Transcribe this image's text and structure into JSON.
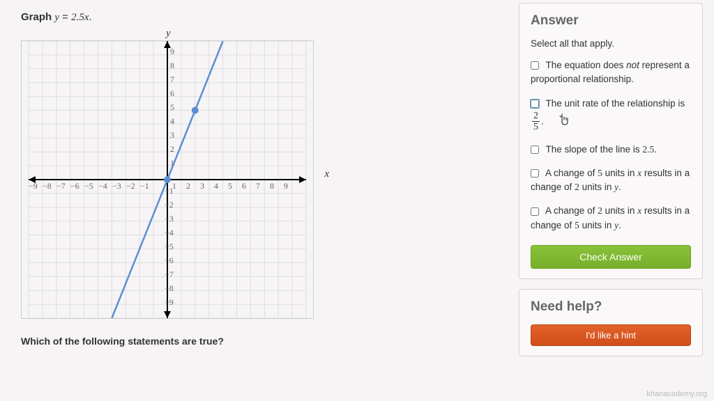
{
  "question": {
    "prefix": "Graph ",
    "equation_lhs": "y",
    "equation_mid": " = ",
    "equation_rhs": "2.5x",
    "suffix": ".",
    "bottom_text": "Which of the following statements are true?"
  },
  "graph": {
    "y_label": "y",
    "x_label": "x",
    "x_ticks": [
      "−9",
      "−8",
      "−7",
      "−6",
      "−5",
      "−4",
      "−3",
      "−2",
      "−1",
      "1",
      "2",
      "3",
      "4",
      "5",
      "6",
      "7",
      "8",
      "9"
    ],
    "y_ticks_pos": [
      "9",
      "8",
      "7",
      "6",
      "5",
      "4",
      "3",
      "2",
      "1"
    ],
    "y_ticks_neg": [
      "−1",
      "−2",
      "−3",
      "−4",
      "−5",
      "−6",
      "−7",
      "−8",
      "−9"
    ]
  },
  "answer": {
    "title": "Answer",
    "instruction": "Select all that apply.",
    "options": [
      {
        "pre": "The equation does ",
        "em": "not",
        "post": " represent a proportional relationship."
      },
      {
        "pre": "The unit rate of the relationship is ",
        "frac_num": "2",
        "frac_den": "5",
        "post2": "."
      },
      {
        "pre": "The slope of the line is ",
        "num": "2.5",
        "post": "."
      },
      {
        "pre": "A change of ",
        "n1": "5",
        "mid1": " units in ",
        "v1": "x",
        "mid2": " results in a change of ",
        "n2": "2",
        "mid3": " units in ",
        "v2": "y",
        "post": "."
      },
      {
        "pre": "A change of ",
        "n1": "2",
        "mid1": " units in ",
        "v1": "x",
        "mid2": " results in a change of ",
        "n2": "5",
        "mid3": " units in ",
        "v2": "y",
        "post": "."
      }
    ],
    "check_label": "Check Answer"
  },
  "help": {
    "title": "Need help?",
    "hint_label": "I'd like a hint"
  },
  "watermark": "khanacademy.org",
  "chart_data": {
    "type": "line",
    "title": "",
    "xlabel": "x",
    "ylabel": "y",
    "xlim": [
      -10,
      10
    ],
    "ylim": [
      -10,
      10
    ],
    "grid": true,
    "series": [
      {
        "name": "y = 2.5x",
        "x": [
          -4,
          0,
          2,
          4
        ],
        "y": [
          -10,
          0,
          5,
          10
        ],
        "color": "#5b8fd1"
      }
    ],
    "points": [
      {
        "x": 0,
        "y": 0,
        "color": "#5b8fd1"
      },
      {
        "x": 2,
        "y": 5,
        "color": "#5b8fd1"
      }
    ],
    "x_ticks": [
      -9,
      -8,
      -7,
      -6,
      -5,
      -4,
      -3,
      -2,
      -1,
      1,
      2,
      3,
      4,
      5,
      6,
      7,
      8,
      9
    ],
    "y_ticks": [
      -9,
      -8,
      -7,
      -6,
      -5,
      -4,
      -3,
      -2,
      -1,
      1,
      2,
      3,
      4,
      5,
      6,
      7,
      8,
      9
    ]
  }
}
